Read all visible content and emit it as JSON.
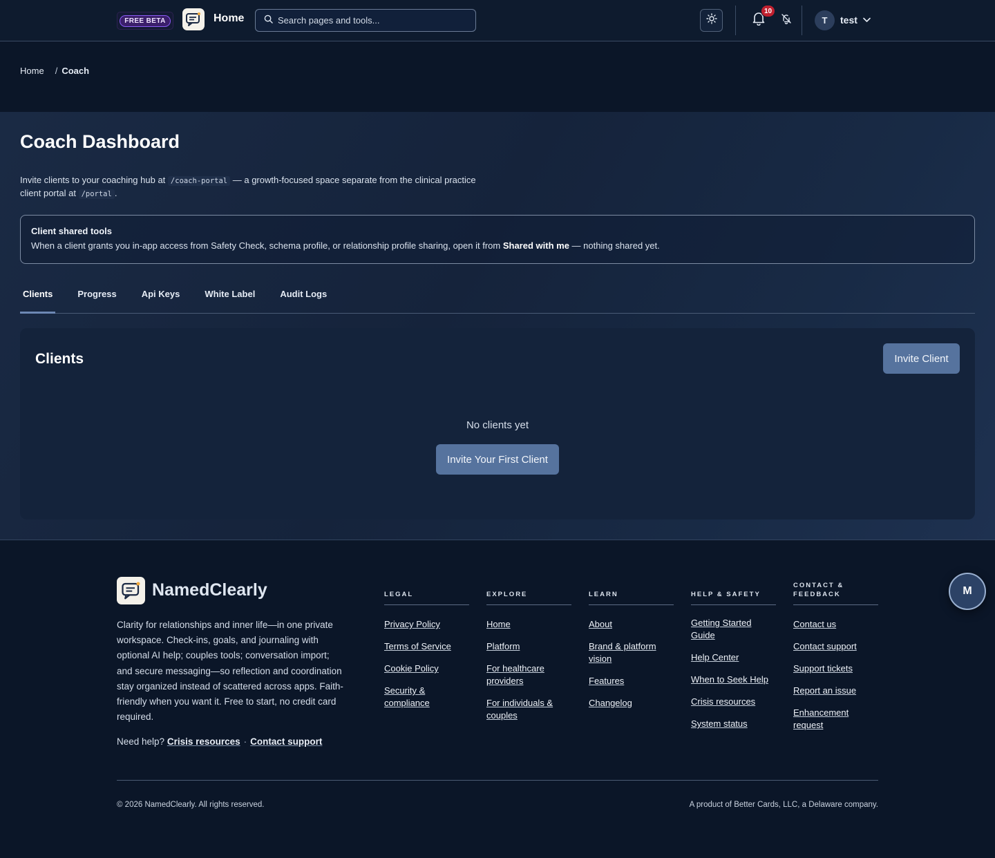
{
  "header": {
    "beta_label": "FREE BETA",
    "title": "Home",
    "search_placeholder": "Search pages and tools...",
    "notification_count": "10",
    "user_initial": "T",
    "user_name": "test"
  },
  "breadcrumb": {
    "home": "Home",
    "separator": "/",
    "current": "Coach"
  },
  "page": {
    "title": "Coach Dashboard",
    "intro_1": "Invite clients to your coaching hub at",
    "intro_code_1": "/coach-portal",
    "intro_2": "— a growth-focused space separate from the clinical practice client portal at",
    "intro_code_2": "/portal",
    "intro_3": "."
  },
  "shared_tools": {
    "title": "Client shared tools",
    "text_before": "When a client grants you in-app access from Safety Check, schema profile, or relationship profile sharing, open it from",
    "bold": "Shared with me",
    "text_after": "— nothing shared yet."
  },
  "tabs": [
    "Clients",
    "Progress",
    "Api Keys",
    "White Label",
    "Audit Logs"
  ],
  "clients": {
    "title": "Clients",
    "invite_button": "Invite Client",
    "empty": "No clients yet",
    "first_button": "Invite Your First Client"
  },
  "footer": {
    "brand": "NamedClearly",
    "description": "Clarity for relationships and inner life—in one private workspace. Check-ins, goals, and journaling with optional AI help; couples tools; conversation import; and secure messaging—so reflection and coordination stay organized instead of scattered across apps. Faith-friendly when you want it. Free to start, no credit card required.",
    "help_label": "Need help?",
    "help_crisis": "Crisis resources",
    "help_dot": "·",
    "help_contact": "Contact support",
    "columns": [
      {
        "heading": "LEGAL",
        "links": [
          "Privacy Policy",
          "Terms of Service",
          "Cookie Policy",
          "Security & compliance"
        ]
      },
      {
        "heading": "EXPLORE",
        "links": [
          "Home",
          "Platform",
          "For healthcare providers",
          "For individuals & couples"
        ]
      },
      {
        "heading": "LEARN",
        "links": [
          "About",
          "Brand & platform vision",
          "Features",
          "Changelog"
        ]
      },
      {
        "heading": "HELP & SAFETY",
        "links": [
          "Getting Started Guide",
          "Help Center",
          "When to Seek Help",
          "Crisis resources",
          "System status"
        ]
      },
      {
        "heading": "CONTACT & FEEDBACK",
        "links": [
          "Contact us",
          "Contact support",
          "Support tickets",
          "Report an issue",
          "Enhancement request"
        ]
      }
    ],
    "copyright": "© 2026 NamedClearly. All rights reserved.",
    "product": "A product of Better Cards, LLC, a Delaware company.",
    "floating_button": "M"
  },
  "colors": {
    "background": "#0b1628",
    "panel": "#14233b",
    "primary_button": "#56739e",
    "beta_accent": "#8b5cf6",
    "badge": "#c0202f"
  },
  "icons": [
    "app-logo-icon",
    "search-icon",
    "sun-icon",
    "bell-icon",
    "bell-off-icon",
    "chevron-down-icon"
  ]
}
